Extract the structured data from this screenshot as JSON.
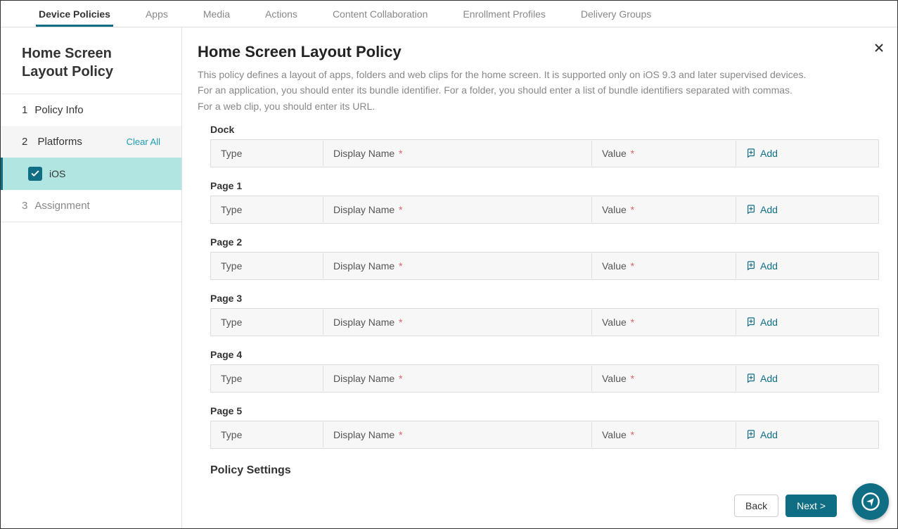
{
  "tabs": {
    "device_policies": "Device Policies",
    "apps": "Apps",
    "media": "Media",
    "actions": "Actions",
    "content_collaboration": "Content Collaboration",
    "enrollment_profiles": "Enrollment Profiles",
    "delivery_groups": "Delivery Groups"
  },
  "sidebar": {
    "title": "Home Screen Layout Policy",
    "step1_num": "1",
    "step1_label": "Policy Info",
    "step2_num": "2",
    "step2_label": "Platforms",
    "clear_all": "Clear All",
    "platform_ios": "iOS",
    "step3_num": "3",
    "step3_label": "Assignment"
  },
  "content": {
    "title": "Home Screen Layout Policy",
    "desc_line1": "This policy defines a layout of apps, folders and web clips for the home screen. It is supported only on iOS 9.3 and later supervised devices.",
    "desc_line2": "For an application, you should enter its bundle identifier. For a folder, you should enter a list of bundle identifiers separated with commas.",
    "desc_line3": "For a web clip, you should enter its URL.",
    "policy_settings": "Policy Settings"
  },
  "columns": {
    "type": "Type",
    "display_name": "Display Name",
    "value": "Value",
    "add": "Add",
    "required": "*"
  },
  "sections": [
    "Dock",
    "Page 1",
    "Page 2",
    "Page 3",
    "Page 4",
    "Page 5"
  ],
  "buttons": {
    "back": "Back",
    "next": "Next >"
  }
}
